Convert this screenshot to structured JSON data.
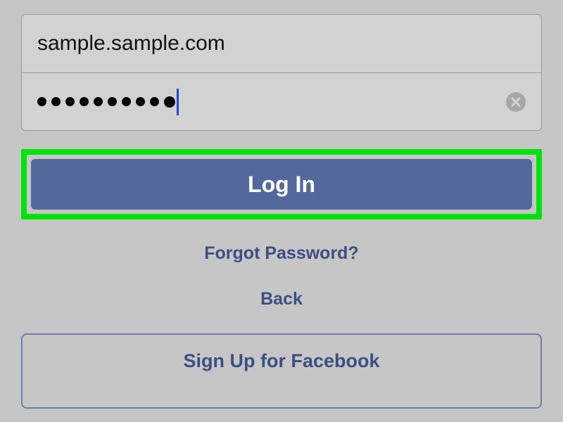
{
  "login": {
    "email_value": "sample.sample.com",
    "password_dot_count": 10,
    "clear_icon": "close-icon"
  },
  "buttons": {
    "login_label": "Log In",
    "signup_label": "Sign Up for Facebook"
  },
  "links": {
    "forgot_label": "Forgot Password?",
    "back_label": "Back"
  },
  "colors": {
    "highlight": "#00e40c",
    "primary_button": "#54699b",
    "link": "#3b4f84",
    "background": "#c6c6c6"
  }
}
